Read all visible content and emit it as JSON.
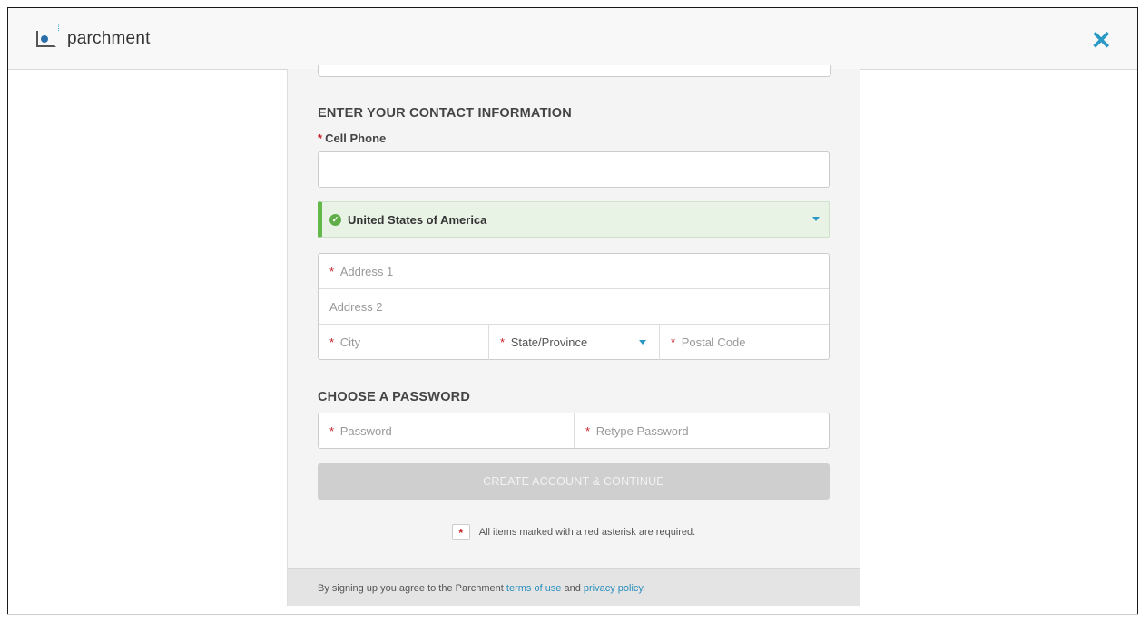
{
  "header": {
    "logo_text": "parchment",
    "close_icon": "close-icon"
  },
  "contact_section": {
    "title": "ENTER YOUR CONTACT INFORMATION",
    "required_mark": "*",
    "cell_phone_label": "Cell Phone",
    "cell_phone_value": "",
    "country_selected": "United States of America",
    "country_status_color": "#63b84a",
    "address1_placeholder": "Address 1",
    "address2_placeholder": "Address 2",
    "city_placeholder": "City",
    "state_placeholder": "State/Province",
    "postal_placeholder": "Postal Code"
  },
  "password_section": {
    "title": "CHOOSE A PASSWORD",
    "password_placeholder": "Password",
    "retype_placeholder": "Retype Password"
  },
  "submit": {
    "label": "CREATE ACCOUNT & CONTINUE"
  },
  "required_note": {
    "marker": "*",
    "text": "All items marked with a red asterisk are required."
  },
  "footer": {
    "prefix": "By signing up you agree to the Parchment ",
    "terms_link": "terms of use",
    "and_text": " and ",
    "privacy_link": "privacy policy",
    "suffix": "."
  },
  "colors": {
    "accent": "#2a99c5",
    "required": "#c3222b"
  }
}
